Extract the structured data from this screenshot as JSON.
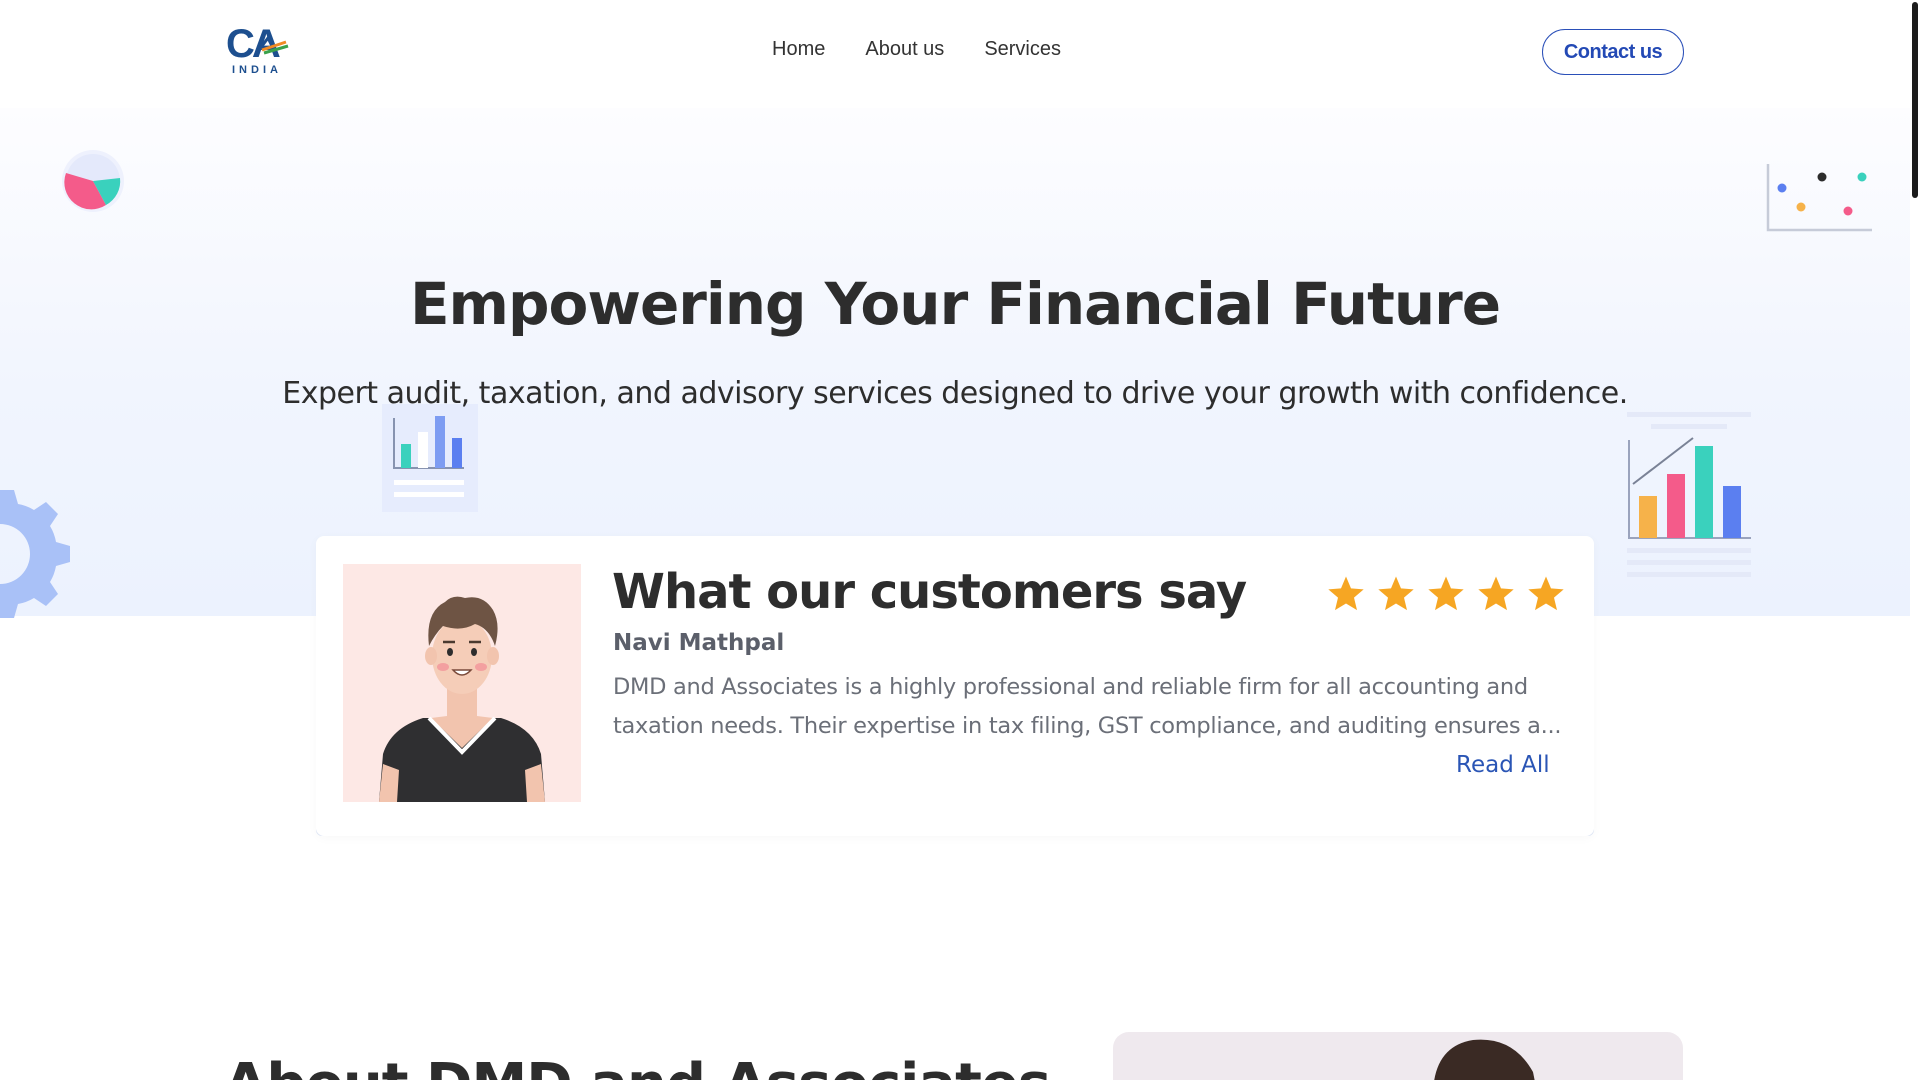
{
  "logo": {
    "main": "CA",
    "sub": "INDIA"
  },
  "nav": {
    "items": [
      {
        "label": "Home"
      },
      {
        "label": "About us"
      },
      {
        "label": "Services"
      }
    ],
    "contact_label": "Contact us"
  },
  "hero": {
    "title": "Empowering Your Financial Future",
    "subtitle": "Expert audit, taxation, and advisory services designed to drive your growth with confidence."
  },
  "testimonial": {
    "heading": "What our customers say",
    "rating": 5,
    "rating_max": 5,
    "reviewer": "Navi Mathpal",
    "review_line1": "DMD and Associates is a highly professional and reliable firm for all accounting and",
    "review_line2": "taxation needs. Their expertise in tax filing, GST compliance, and auditing ensures a...",
    "read_all_label": "Read All"
  },
  "about": {
    "title": "About DMD and Associates"
  },
  "colors": {
    "brand_blue": "#2349b5",
    "star_orange": "#f6a623",
    "text_dark": "#2d2d2d",
    "avatar_bg": "#fde8e5"
  },
  "icons": [
    "ca-india-logo",
    "pie-chart-icon",
    "scatter-plot-icon",
    "bar-chart-report-icon",
    "growth-bar-chart-icon",
    "gear-icon",
    "star-icon"
  ]
}
